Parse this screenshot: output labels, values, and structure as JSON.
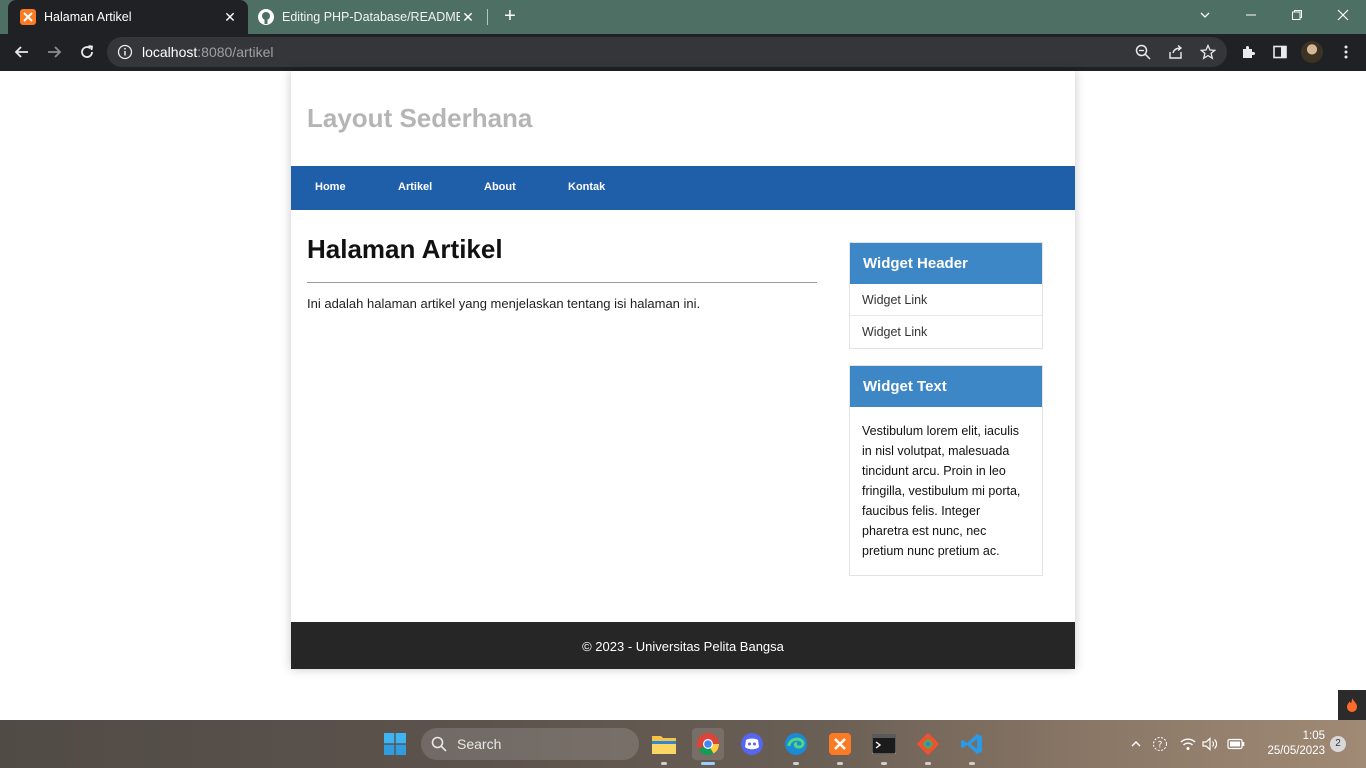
{
  "browser": {
    "tabs": [
      {
        "title": "Halaman Artikel",
        "active": true,
        "favicon": "xampp-icon"
      },
      {
        "title": "Editing PHP-Database/README.m",
        "active": false,
        "favicon": "github-icon"
      }
    ],
    "url_host": "localhost",
    "url_rest": ":8080/artikel"
  },
  "site": {
    "title": "Layout Sederhana",
    "nav": [
      "Home",
      "Artikel",
      "About",
      "Kontak"
    ],
    "article": {
      "heading": "Halaman Artikel",
      "body": "Ini adalah halaman artikel yang menjelaskan tentang isi halaman ini."
    },
    "widgets": {
      "links_header": "Widget Header",
      "links": [
        "Widget Link",
        "Widget Link"
      ],
      "text_header": "Widget Text",
      "text_body": "Vestibulum lorem elit, iaculis in nisl volutpat, malesuada tincidunt arcu. Proin in leo fringilla, vestibulum mi porta, faucibus felis. Integer pharetra est nunc, nec pretium nunc pretium ac."
    },
    "footer": "© 2023 - Universitas Pelita Bangsa"
  },
  "taskbar": {
    "search_label": "Search",
    "time": "1:05",
    "date": "25/05/2023",
    "notification_count": "2"
  },
  "colors": {
    "nav_bg": "#1f5faa",
    "widget_header_bg": "#3d87c7",
    "footer_bg": "#262626",
    "tabstrip_bg": "#4e6f64"
  }
}
